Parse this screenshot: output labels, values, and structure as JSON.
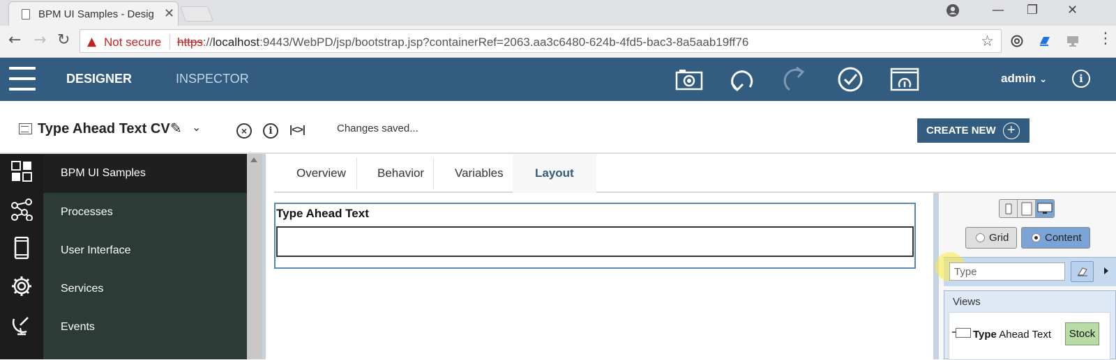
{
  "browser": {
    "tab_title": "BPM UI Samples - Desig",
    "security_label": "Not secure",
    "url_scheme": "https",
    "url_sep": "://",
    "url_host": "localhost",
    "url_rest": ":9443/WebPD/jsp/bootstrap.jsp?containerRef=2063.aa3c6480-624b-4fd5-bac3-8a5aab19ff76"
  },
  "appbar": {
    "designer": "DESIGNER",
    "inspector": "INSPECTOR",
    "user": "admin"
  },
  "doc_toolbar": {
    "title": "Type Ahead Text CV",
    "status": "Changes saved...",
    "create_new": "CREATE NEW"
  },
  "sidebar": {
    "items": [
      {
        "label": "BPM UI Samples",
        "icon": "dashboard-icon"
      },
      {
        "label": "Processes",
        "icon": "process-icon"
      },
      {
        "label": "User Interface",
        "icon": "mobile-icon"
      },
      {
        "label": "Services",
        "icon": "gear-icon"
      },
      {
        "label": "Events",
        "icon": "satellite-icon"
      }
    ]
  },
  "editor": {
    "tabs": [
      "Overview",
      "Behavior",
      "Variables",
      "Layout"
    ],
    "active_tab": "Layout",
    "field_label": "Type Ahead Text"
  },
  "palette": {
    "mode_grid": "Grid",
    "mode_content": "Content",
    "selected_mode": "Content",
    "search_value": "Type",
    "views_title": "Views",
    "view_item_bold": "Type",
    "view_item_rest": " Ahead Text",
    "view_item_badge": "Stock"
  },
  "colors": {
    "header_bg": "#325c80",
    "sidebar_bg": "#2c3b36",
    "rail_bg": "#1c1c1c",
    "accent": "#325c80",
    "stock_badge": "#b9dba6"
  }
}
